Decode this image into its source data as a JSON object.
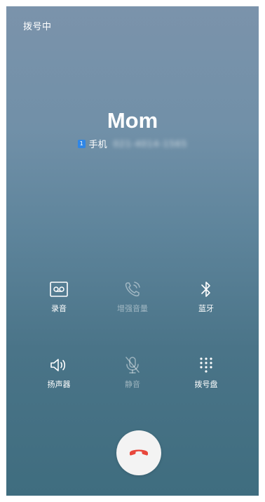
{
  "status": {
    "text": "拨号中"
  },
  "contact": {
    "name": "Mom",
    "sim_label": "1",
    "number_type": "手机",
    "number": "021-4014-1565"
  },
  "controls": {
    "record": {
      "label": "录音",
      "icon": "record-icon",
      "enabled": true
    },
    "enhance_volume": {
      "label": "增强音量",
      "icon": "phone-volume-icon",
      "enabled": false
    },
    "bluetooth": {
      "label": "蓝牙",
      "icon": "bluetooth-icon",
      "enabled": true
    },
    "speaker": {
      "label": "扬声器",
      "icon": "speaker-icon",
      "enabled": true
    },
    "mute": {
      "label": "静音",
      "icon": "mic-off-icon",
      "enabled": false
    },
    "dialpad": {
      "label": "拨号盘",
      "icon": "dialpad-icon",
      "enabled": true
    }
  },
  "end_call": {
    "icon": "hang-up-icon",
    "color": "#e8473c"
  },
  "colors": {
    "background_top": "#7b93ab",
    "background_bottom": "#3f6d7f",
    "sim_badge": "#2f86e6",
    "end_call_button": "#f3f3f3"
  }
}
